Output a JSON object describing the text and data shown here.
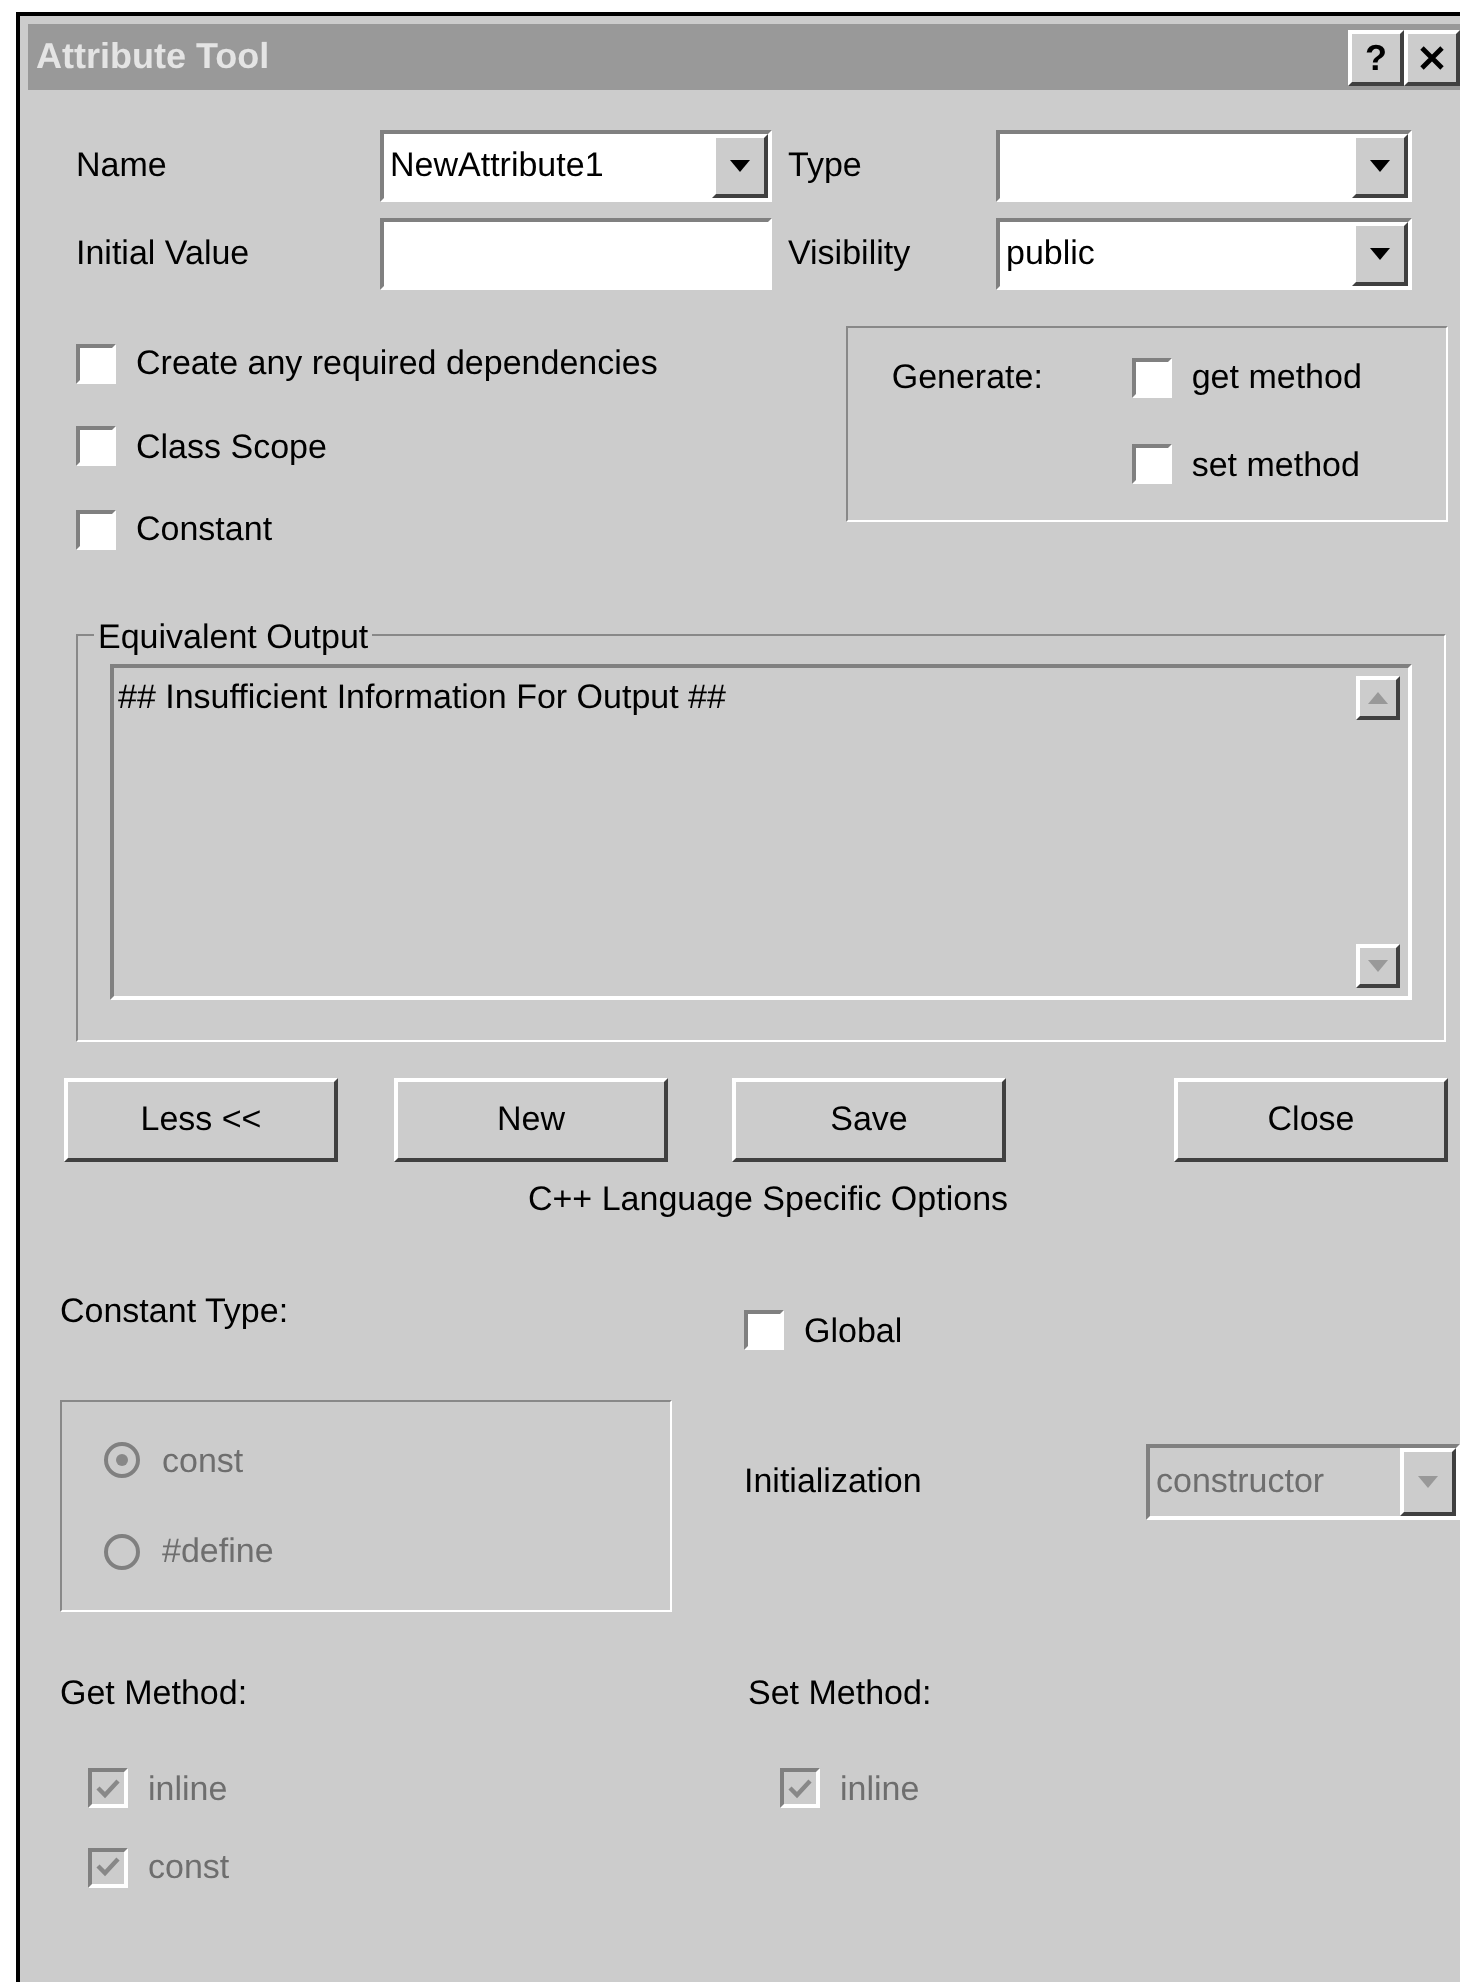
{
  "window": {
    "title": "Attribute Tool",
    "help": "?"
  },
  "fields": [
    {
      "label": "Name",
      "kind": "combo",
      "value": "NewAttribute1"
    },
    {
      "label": "Type",
      "kind": "combo"
    },
    {
      "label": "Initial Value",
      "kind": "text"
    },
    {
      "label": "Visibility",
      "kind": "combo",
      "value": "public"
    }
  ],
  "options": [
    {
      "label": "Create any required dependencies",
      "checked": false
    },
    {
      "label": "Class Scope",
      "checked": false
    },
    {
      "label": "Constant",
      "checked": false
    }
  ],
  "generate": {
    "label": "Generate:",
    "options": [
      {
        "label": "get method",
        "checked": false
      },
      {
        "label": "set method",
        "checked": false
      }
    ]
  },
  "output": {
    "legend": "Equivalent Output",
    "text": "## Insufficient Information For Output ##"
  },
  "buttons": [
    "Less <<",
    "New",
    "Save",
    "Close"
  ],
  "cpp": {
    "title": "C++ Language Specific Options",
    "constant_type": {
      "label": "Constant Type:",
      "options": [
        {
          "label": "const",
          "selected": true,
          "disabled": true
        },
        {
          "label": "#define",
          "selected": false,
          "disabled": true
        }
      ]
    },
    "global": {
      "label": "Global",
      "checked": false
    },
    "initialization": {
      "label": "Initialization",
      "value": "constructor",
      "disabled": true
    },
    "get_method": {
      "label": "Get Method:",
      "options": [
        {
          "label": "inline",
          "checked": true,
          "disabled": true
        },
        {
          "label": "const",
          "checked": true,
          "disabled": true
        }
      ]
    },
    "set_method": {
      "label": "Set Method:",
      "options": [
        {
          "label": "inline",
          "checked": true,
          "disabled": true
        }
      ]
    }
  }
}
